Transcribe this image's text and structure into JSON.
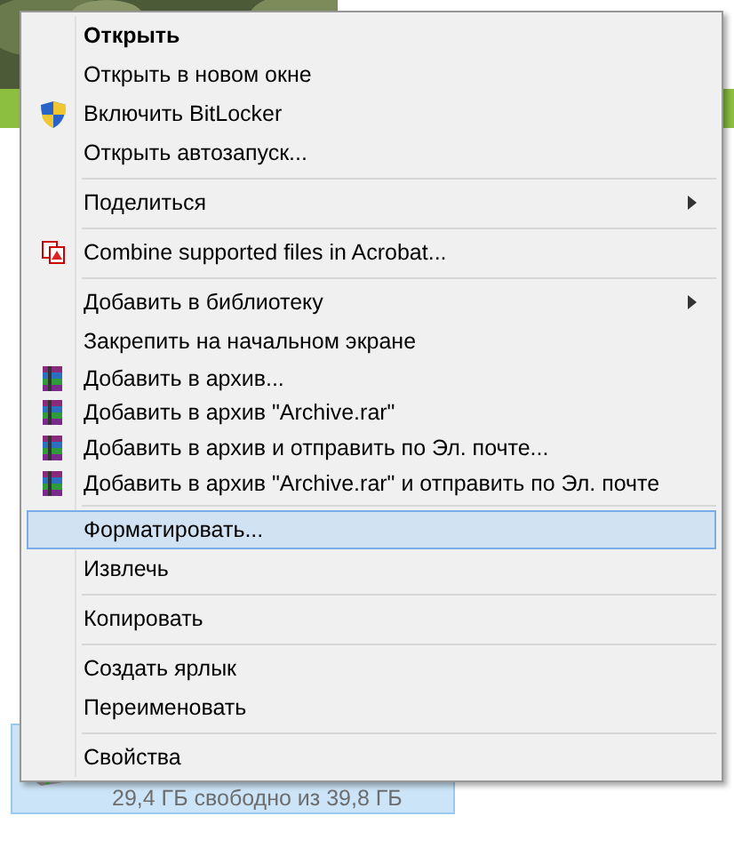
{
  "drive_tile": {
    "selected": true,
    "free_space": "29,4 ГБ свободно из 39,8 ГБ"
  },
  "context_menu": {
    "items": [
      {
        "kind": "plain",
        "label": "Открыть",
        "default": true,
        "submenu": false,
        "selected": false
      },
      {
        "kind": "plain",
        "label": "Открыть в новом окне",
        "default": false,
        "submenu": false,
        "selected": false
      },
      {
        "kind": "shield",
        "label": "Включить BitLocker",
        "default": false,
        "submenu": false,
        "selected": false
      },
      {
        "kind": "plain",
        "label": "Открыть автозапуск...",
        "default": false,
        "submenu": false,
        "selected": false
      },
      {
        "kind": "separator"
      },
      {
        "kind": "plain",
        "label": "Поделиться",
        "default": false,
        "submenu": true,
        "selected": false
      },
      {
        "kind": "separator"
      },
      {
        "kind": "acrobat",
        "label": "Combine supported files in Acrobat...",
        "default": false,
        "submenu": false,
        "selected": false
      },
      {
        "kind": "separator"
      },
      {
        "kind": "plain",
        "label": "Добавить в библиотеку",
        "default": false,
        "submenu": true,
        "selected": false
      },
      {
        "kind": "plain",
        "label": "Закрепить на начальном экране",
        "default": false,
        "submenu": false,
        "selected": false
      },
      {
        "kind": "archive",
        "label": "Добавить в архив...",
        "default": false,
        "submenu": false,
        "selected": false
      },
      {
        "kind": "archive",
        "label": "Добавить в архив \"Archive.rar\"",
        "default": false,
        "submenu": false,
        "selected": false
      },
      {
        "kind": "archive",
        "label": "Добавить в архив и отправить по Эл. почте...",
        "default": false,
        "submenu": false,
        "selected": false
      },
      {
        "kind": "archive",
        "label": "Добавить в архив \"Archive.rar\" и отправить по Эл. почте",
        "default": false,
        "submenu": false,
        "selected": false
      },
      {
        "kind": "separator"
      },
      {
        "kind": "plain",
        "label": "Форматировать...",
        "default": false,
        "submenu": false,
        "selected": true
      },
      {
        "kind": "plain",
        "label": "Извлечь",
        "default": false,
        "submenu": false,
        "selected": false
      },
      {
        "kind": "separator"
      },
      {
        "kind": "plain",
        "label": "Копировать",
        "default": false,
        "submenu": false,
        "selected": false
      },
      {
        "kind": "separator"
      },
      {
        "kind": "plain",
        "label": "Создать ярлык",
        "default": false,
        "submenu": false,
        "selected": false
      },
      {
        "kind": "plain",
        "label": "Переименовать",
        "default": false,
        "submenu": false,
        "selected": false
      },
      {
        "kind": "separator"
      },
      {
        "kind": "plain",
        "label": "Свойства",
        "default": false,
        "submenu": false,
        "selected": false
      }
    ]
  }
}
